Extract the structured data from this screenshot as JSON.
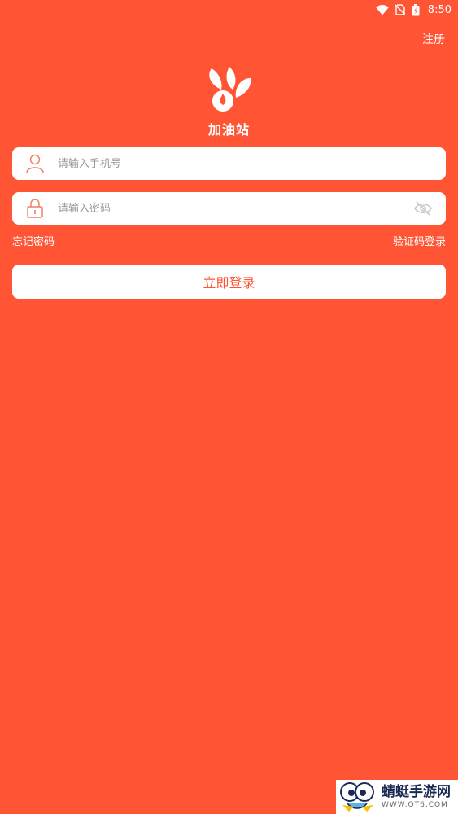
{
  "status_bar": {
    "time": "8:50"
  },
  "header": {
    "register_label": "注册"
  },
  "logo": {
    "text": "加油站"
  },
  "form": {
    "phone_placeholder": "请输入手机号",
    "password_placeholder": "请输入密码",
    "forgot_label": "忘记密码",
    "code_login_label": "验证码登录",
    "login_label": "立即登录"
  },
  "watermark": {
    "title": "蜻蜓手游网",
    "url": "WWW.QT6.COM"
  },
  "colors": {
    "background": "#FF5535",
    "icon": "#F07A62",
    "eye": "#C8C8C8"
  },
  "icons": [
    "wifi-icon",
    "no-sim-icon",
    "battery-icon",
    "user-icon",
    "lock-icon",
    "eye-off-icon"
  ]
}
